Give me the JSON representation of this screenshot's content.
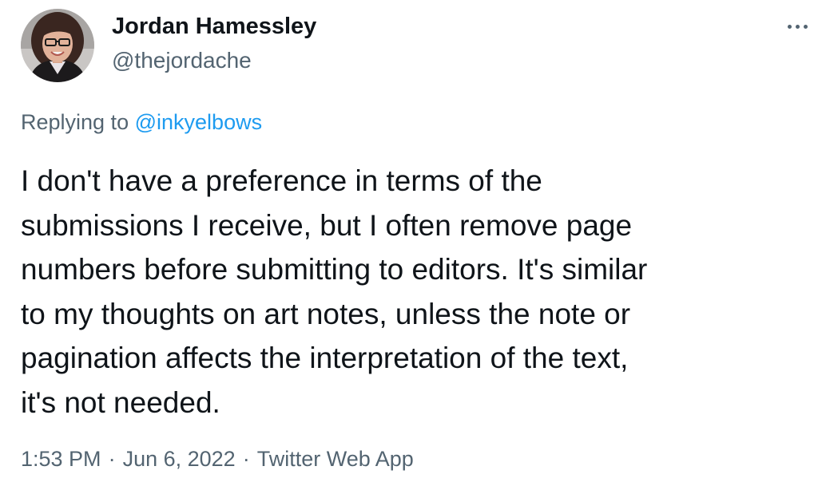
{
  "tweet": {
    "author": {
      "name": "Jordan Hamessley",
      "handle": "@thejordache"
    },
    "more_icon": "more-horizontal-icon",
    "replying_prefix": "Replying to",
    "replying_to": "@inkyelbows",
    "text": "I don't have a preference in terms of the\nsubmissions I receive, but I often remove page\nnumbers before submitting to editors. It's similar\nto my thoughts on art notes, unless the note or\npagination affects the interpretation of the text,\nit's not needed.",
    "time": "1:53 PM",
    "separator": "·",
    "date": "Jun 6, 2022",
    "source": "Twitter Web App"
  },
  "colors": {
    "text_primary": "#0f1419",
    "text_secondary": "#536471",
    "link": "#1d9bf0",
    "background": "#ffffff"
  }
}
